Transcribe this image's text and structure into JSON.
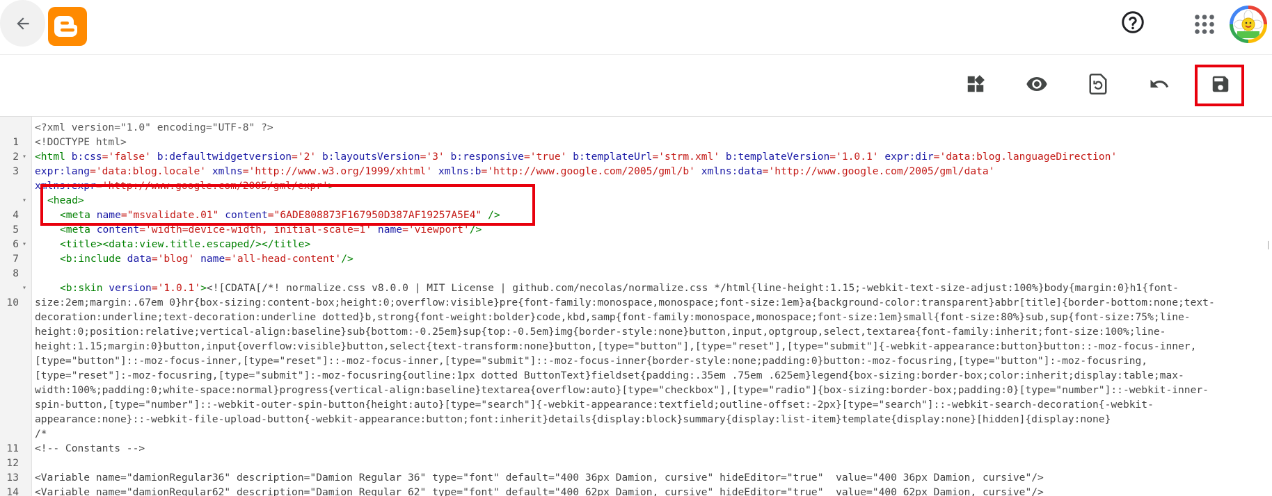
{
  "header": {
    "back_label": "",
    "help_label": "",
    "apps_label": ""
  },
  "toolbar": {
    "tools": [
      {
        "name": "layout-widgets",
        "icon": "widgets-icon"
      },
      {
        "name": "preview",
        "icon": "eye-icon"
      },
      {
        "name": "restore",
        "icon": "restore-icon"
      },
      {
        "name": "undo",
        "icon": "undo-icon"
      },
      {
        "name": "save",
        "icon": "save-icon"
      }
    ]
  },
  "colors": {
    "blogger_orange": "#ff8a00",
    "highlight_red": "#e8000c",
    "tag_green": "#008000",
    "attr_blue": "#1a1aa6",
    "value_red": "#c41a16"
  },
  "code": {
    "l1": "<?xml version=\"1.0\" encoding=\"UTF-8\" ?>",
    "l2": "<!DOCTYPE html>",
    "l3": {
      "open": "<html ",
      "a1": "b:css",
      "v1": "='false' ",
      "a2": "b:defaultwidgetversion",
      "v2": "='2' ",
      "a3": "b:layoutsVersion",
      "v3": "='3' ",
      "a4": "b:responsive",
      "v4": "='true' ",
      "a5": "b:templateUrl",
      "v5": "='strm.xml' ",
      "a6": "b:templateVersion",
      "v6": "='1.0.1' ",
      "a7": "expr:dir",
      "v7": "='data:blog.languageDirection'",
      "a8": "expr:lang",
      "v8": "='data:blog.locale' ",
      "a9": "xmlns",
      "v9": "='http://www.w3.org/1999/xhtml' ",
      "a10": "xmlns:b",
      "v10": "='http://www.google.com/2005/gml/b' ",
      "a11": "xmlns:data",
      "v11": "='http://www.google.com/2005/gml/data'",
      "a12": "xmlns:expr",
      "v12": "='http://www.google.com/2005/gml/expr'",
      "close": ">"
    },
    "l4": "<head>",
    "l5": {
      "open": "<meta ",
      "a1": "name",
      "v1": "=\"msvalidate.01\" ",
      "a2": "content",
      "v2": "=\"6ADE808873F167950D387AF19257A5E4\" ",
      "close": "/>"
    },
    "l6": {
      "open": "<meta ",
      "a1": "content",
      "v1": "='width=device-width, initial-scale=1' ",
      "a2": "name",
      "v2": "='viewport'",
      "close": "/>"
    },
    "l7": {
      "open": "<title>",
      "tag2": "<data:view.title.escaped/>",
      "close": "</title>"
    },
    "l8": {
      "open": "<b:include ",
      "a1": "data",
      "v1": "='blog' ",
      "a2": "name",
      "v2": "='all-head-content'",
      "close": "/>"
    },
    "l10": {
      "open": "<b:skin ",
      "a1": "version",
      "v1": "='1.0.1'",
      "close": ">",
      "cdata_1": "<![CDATA[/*! normalize.css v8.0.0 | MIT License | github.com/necolas/normalize.css */html{line-height:1.15;-webkit-text-size-adjust:100%}body{margin:0}h1{font-",
      "cdata_2": "size:2em;margin:.67em 0}hr{box-sizing:content-box;height:0;overflow:visible}pre{font-family:monospace,monospace;font-size:1em}a{background-color:transparent}abbr[title]{border-bottom:none;text-",
      "cdata_3": "decoration:underline;text-decoration:underline dotted}b,strong{font-weight:bolder}code,kbd,samp{font-family:monospace,monospace;font-size:1em}small{font-size:80%}sub,sup{font-size:75%;line-",
      "cdata_4": "height:0;position:relative;vertical-align:baseline}sub{bottom:-0.25em}sup{top:-0.5em}img{border-style:none}button,input,optgroup,select,textarea{font-family:inherit;font-size:100%;line-",
      "cdata_5": "height:1.15;margin:0}button,input{overflow:visible}button,select{text-transform:none}button,[type=\"button\"],[type=\"reset\"],[type=\"submit\"]{-webkit-appearance:button}button::-moz-focus-inner,",
      "cdata_6": "[type=\"button\"]::-moz-focus-inner,[type=\"reset\"]::-moz-focus-inner,[type=\"submit\"]::-moz-focus-inner{border-style:none;padding:0}button:-moz-focusring,[type=\"button\"]:-moz-focusring,",
      "cdata_7": "[type=\"reset\"]:-moz-focusring,[type=\"submit\"]:-moz-focusring{outline:1px dotted ButtonText}fieldset{padding:.35em .75em .625em}legend{box-sizing:border-box;color:inherit;display:table;max-",
      "cdata_8": "width:100%;padding:0;white-space:normal}progress{vertical-align:baseline}textarea{overflow:auto}[type=\"checkbox\"],[type=\"radio\"]{box-sizing:border-box;padding:0}[type=\"number\"]::-webkit-inner-",
      "cdata_9": "spin-button,[type=\"number\"]::-webkit-outer-spin-button{height:auto}[type=\"search\"]{-webkit-appearance:textfield;outline-offset:-2px}[type=\"search\"]::-webkit-search-decoration{-webkit-",
      "cdata_10": "appearance:none}::-webkit-file-upload-button{-webkit-appearance:button;font:inherit}details{display:block}summary{display:list-item}template{display:none}[hidden]{display:none}"
    },
    "l11": "/*",
    "l12": "<!-- Constants -->",
    "l14": {
      "open": "<Variable ",
      "a1": "name",
      "v1": "=\"damionRegular36\" ",
      "a2": "description",
      "v2": "=\"Damion Regular 36\" ",
      "a3": "type",
      "v3": "=\"font\" ",
      "a4": "default",
      "v4": "=\"400 36px Damion, cursive\" ",
      "a5": "hideEditor",
      "v5": "=\"true\"  ",
      "a6": "value",
      "v6": "=\"400 36px Damion, cursive\"",
      "close": "/>"
    },
    "l15": {
      "open": "<Variable ",
      "a1": "name",
      "v1": "=\"damionRegular62\" ",
      "a2": "description",
      "v2": "=\"Damion Regular 62\" ",
      "a3": "type",
      "v3": "=\"font\" ",
      "a4": "default",
      "v4": "=\"400 62px Damion, cursive\" ",
      "a5": "hideEditor",
      "v5": "=\"true\"  ",
      "a6": "value",
      "v6": "=\"400 62px Damion, cursive\"",
      "close": "/>"
    }
  },
  "line_numbers": [
    "1",
    "2",
    "3",
    "4",
    "5",
    "6",
    "7",
    "8",
    "10",
    "11",
    "12",
    "13",
    "14"
  ]
}
